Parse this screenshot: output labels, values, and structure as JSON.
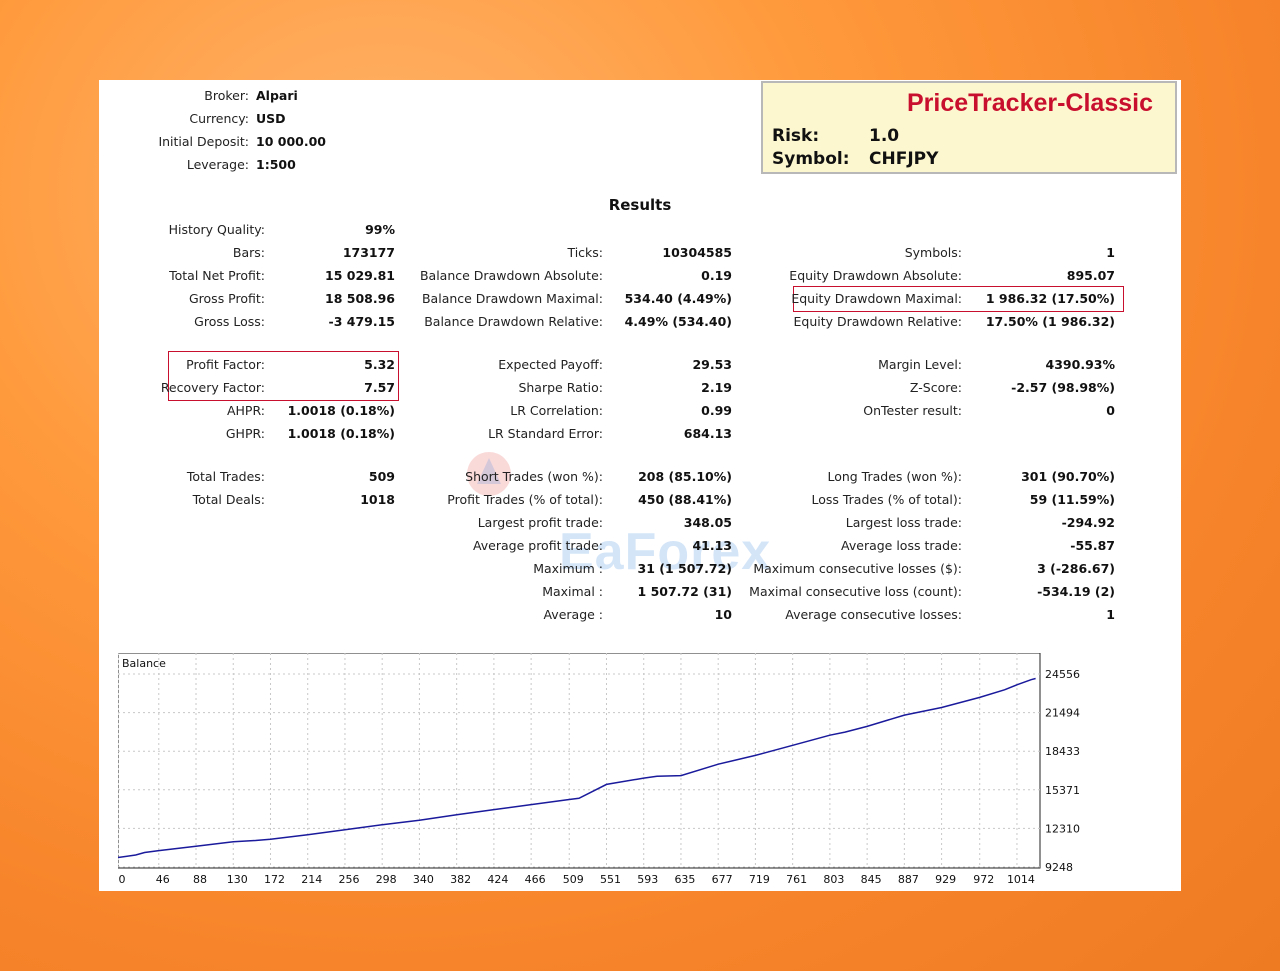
{
  "header": {
    "broker_label": "Broker:",
    "broker": "Alpari",
    "currency_label": "Currency:",
    "currency": "USD",
    "deposit_label": "Initial Deposit:",
    "deposit": "10 000.00",
    "leverage_label": "Leverage:",
    "leverage": "1:500"
  },
  "info_box": {
    "ea_name": "PriceTracker-Classic",
    "risk_label": "Risk:",
    "risk": "1.0",
    "symbol_label": "Symbol:",
    "symbol": "CHFJPY",
    "title_color": "#c8102e",
    "background": "#fdf7cf"
  },
  "results": {
    "title": "Results",
    "col1": {
      "history_quality_label": "History Quality:",
      "history_quality": "99%",
      "bars_label": "Bars:",
      "bars": "173177",
      "net_profit_label": "Total Net Profit:",
      "net_profit": "15 029.81",
      "gross_profit_label": "Gross Profit:",
      "gross_profit": "18 508.96",
      "gross_loss_label": "Gross Loss:",
      "gross_loss": "-3 479.15",
      "profit_factor_label": "Profit Factor:",
      "profit_factor": "5.32",
      "recovery_factor_label": "Recovery Factor:",
      "recovery_factor": "7.57",
      "ahpr_label": "AHPR:",
      "ahpr": "1.0018 (0.18%)",
      "ghpr_label": "GHPR:",
      "ghpr": "1.0018 (0.18%)",
      "total_trades_label": "Total Trades:",
      "total_trades": "509",
      "total_deals_label": "Total Deals:",
      "total_deals": "1018"
    },
    "col2": {
      "ticks_label": "Ticks:",
      "ticks": "10304585",
      "bal_dd_abs_label": "Balance Drawdown Absolute:",
      "bal_dd_abs": "0.19",
      "bal_dd_max_label": "Balance Drawdown Maximal:",
      "bal_dd_max": "534.40 (4.49%)",
      "bal_dd_rel_label": "Balance Drawdown Relative:",
      "bal_dd_rel": "4.49% (534.40)",
      "expected_payoff_label": "Expected Payoff:",
      "expected_payoff": "29.53",
      "sharpe_label": "Sharpe Ratio:",
      "sharpe": "2.19",
      "lr_corr_label": "LR Correlation:",
      "lr_corr": "0.99",
      "lr_err_label": "LR Standard Error:",
      "lr_err": "684.13",
      "short_label": "Short Trades (won %):",
      "short": "208 (85.10%)",
      "profit_trades_label": "Profit Trades (% of total):",
      "profit_trades": "450 (88.41%)",
      "largest_profit_label": "Largest profit trade:",
      "largest_profit": "348.05",
      "avg_profit_label": "Average profit trade:",
      "avg_profit": "41.13",
      "maximum_label": "Maximum :",
      "maximum": "31 (1 507.72)",
      "maximal_label": "Maximal :",
      "maximal": "1 507.72 (31)",
      "average_label": "Average :",
      "average": "10"
    },
    "col3": {
      "symbols_label": "Symbols:",
      "symbols": "1",
      "eq_dd_abs_label": "Equity Drawdown Absolute:",
      "eq_dd_abs": "895.07",
      "eq_dd_max_label": "Equity Drawdown Maximal:",
      "eq_dd_max": "1 986.32 (17.50%)",
      "eq_dd_rel_label": "Equity Drawdown Relative:",
      "eq_dd_rel": "17.50% (1 986.32)",
      "margin_label": "Margin Level:",
      "margin": "4390.93%",
      "zscore_label": "Z-Score:",
      "zscore": "-2.57 (98.98%)",
      "ontester_label": "OnTester result:",
      "ontester": "0",
      "long_label": "Long Trades (won %):",
      "long": "301 (90.70%)",
      "loss_trades_label": "Loss Trades (% of total):",
      "loss_trades": "59 (11.59%)",
      "largest_loss_label": "Largest loss trade:",
      "largest_loss": "-294.92",
      "avg_loss_label": "Average loss trade:",
      "avg_loss": "-55.87",
      "max_consec_losses_label": "Maximum consecutive losses ($):",
      "max_consec_losses": "3 (-286.67)",
      "maximal_consec_loss_label": "Maximal consecutive loss (count):",
      "maximal_consec_loss": "-534.19 (2)",
      "avg_consec_losses_label": "Average consecutive losses:",
      "avg_consec_losses": "1"
    }
  },
  "watermark": "EaForex",
  "highlight_color": "#c8102e",
  "chart_data": {
    "type": "line",
    "title": "Balance",
    "xlabel": "",
    "ylabel": "",
    "x_ticks": [
      0,
      46,
      88,
      130,
      172,
      214,
      256,
      298,
      340,
      382,
      424,
      466,
      509,
      551,
      593,
      635,
      677,
      719,
      761,
      803,
      845,
      887,
      929,
      972,
      1014
    ],
    "y_ticks": [
      9248,
      12310,
      15371,
      18433,
      21494,
      24556
    ],
    "xlim": [
      0,
      1040
    ],
    "ylim": [
      9248,
      24556
    ],
    "grid": true,
    "line_color": "#1a1a9c",
    "series": [
      {
        "x": [
          0,
          20,
          30,
          46,
          88,
          130,
          155,
          172,
          214,
          256,
          298,
          340,
          382,
          424,
          466,
          509,
          520,
          551,
          593,
          608,
          635,
          677,
          719,
          761,
          803,
          820,
          845,
          887,
          929,
          972,
          1000,
          1014,
          1030,
          1035
        ],
        "values": [
          10000,
          10200,
          10400,
          10550,
          10900,
          11250,
          11350,
          11450,
          11800,
          12200,
          12600,
          12950,
          13400,
          13800,
          14200,
          14600,
          14700,
          15800,
          16300,
          16450,
          16500,
          17400,
          18100,
          18900,
          19700,
          19950,
          20400,
          21300,
          21900,
          22700,
          23300,
          23700,
          24100,
          24200
        ]
      }
    ]
  }
}
